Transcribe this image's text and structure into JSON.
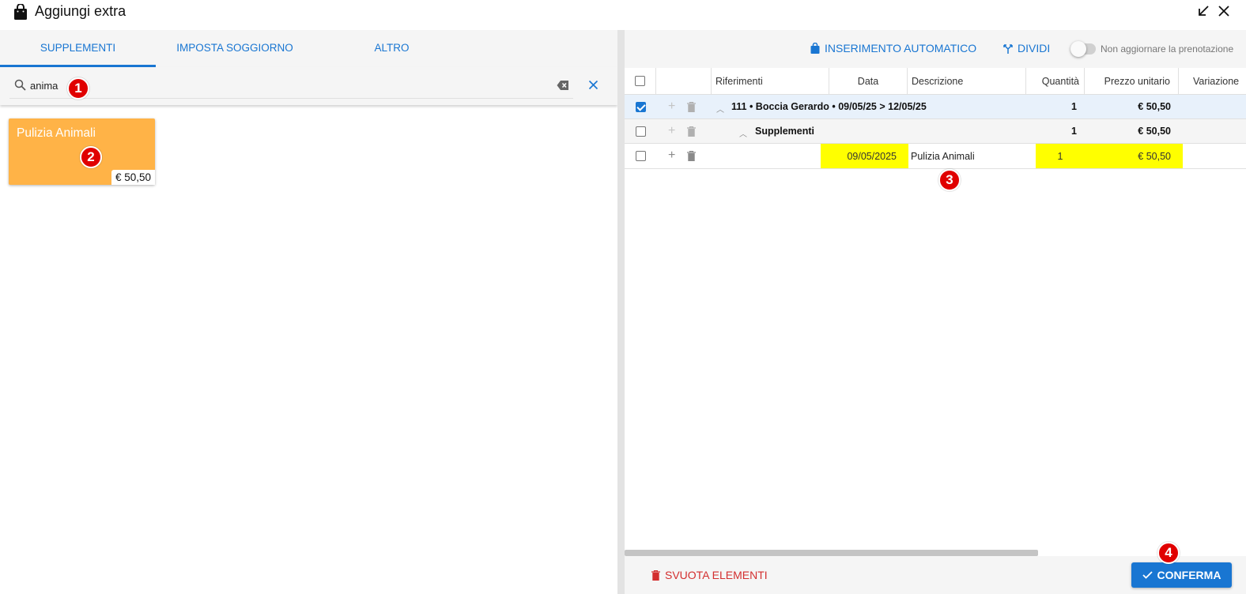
{
  "window": {
    "title": "Aggiungi extra"
  },
  "tabs": [
    {
      "label": "SUPPLEMENTI"
    },
    {
      "label": "IMPOSTA SOGGIORNO"
    },
    {
      "label": "ALTRO"
    }
  ],
  "search": {
    "value": "anima"
  },
  "products": [
    {
      "name": "Pulizia Animali",
      "price": "€ 50,50",
      "color": "#ffb347"
    }
  ],
  "toolbar": {
    "auto_insert_label": "INSERIMENTO AUTOMATICO",
    "split_label": "DIVIDI",
    "toggle_label": "Non aggiornare la prenotazione"
  },
  "grid": {
    "columns": [
      "Riferimenti",
      "Data",
      "Descrizione",
      "Quantità",
      "Prezzo unitario",
      "Variazione"
    ],
    "rows": [
      {
        "label": "111 • Boccia Gerardo • 09/05/25 > 12/05/25",
        "quantity": "1",
        "price": "€ 50,50",
        "checked": true
      },
      {
        "label": "Supplementi",
        "quantity": "1",
        "price": "€ 50,50",
        "checked": false
      },
      {
        "date": "09/05/2025",
        "description": "Pulizia Animali",
        "quantity": "1",
        "price": "€ 50,50",
        "checked": false
      }
    ]
  },
  "footer": {
    "empty_label": "SVUOTA ELEMENTI",
    "confirm_label": "CONFERMA"
  },
  "annotations": [
    "1",
    "2",
    "3",
    "4"
  ],
  "colors": {
    "accent": "#1976d2",
    "danger": "#d32f2f",
    "highlight": "#ffff00",
    "badge": "#e00000"
  }
}
